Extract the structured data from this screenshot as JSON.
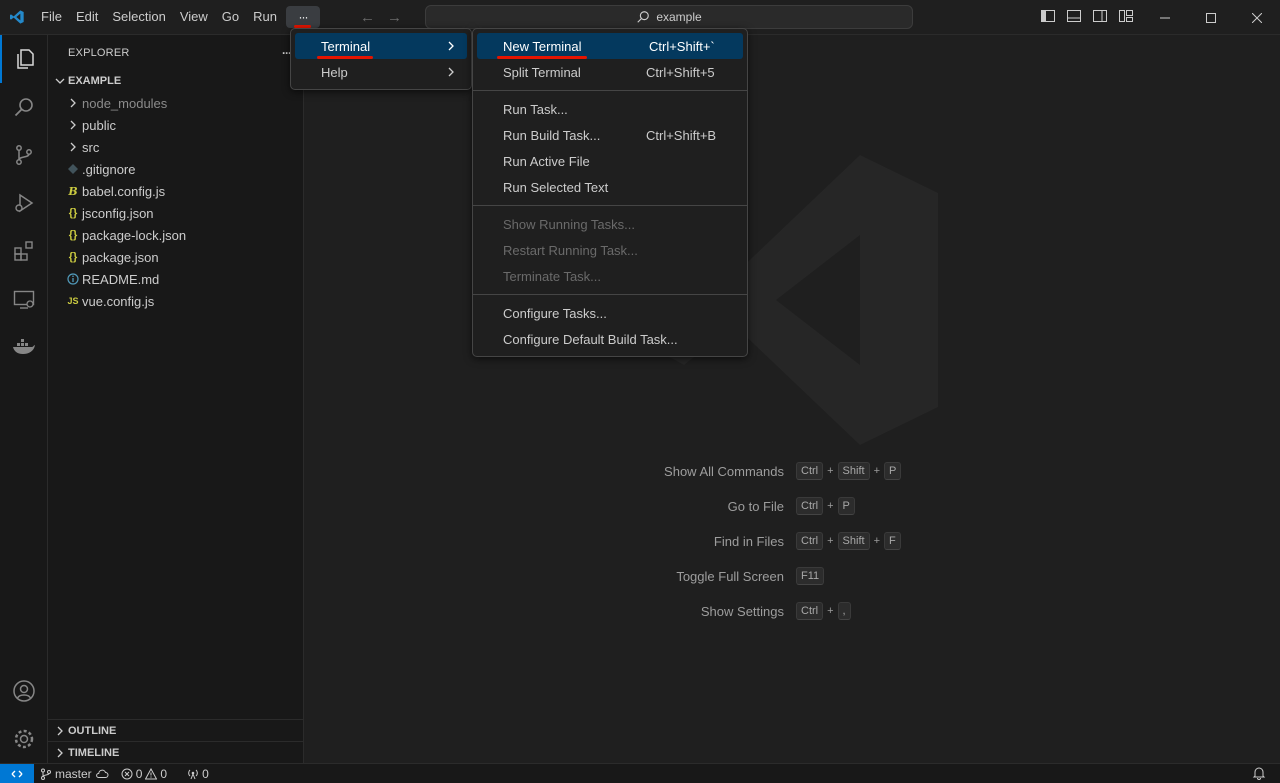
{
  "titlebar": {
    "menus": [
      "File",
      "Edit",
      "Selection",
      "View",
      "Go",
      "Run"
    ],
    "more_label": "···",
    "search_text": "example"
  },
  "sidebar": {
    "header": "EXPLORER",
    "header_more": "···",
    "folder": "EXAMPLE",
    "items": [
      {
        "label": "node_modules",
        "type": "folder"
      },
      {
        "label": "public",
        "type": "folder"
      },
      {
        "label": "src",
        "type": "folder"
      },
      {
        "label": ".gitignore",
        "type": "git"
      },
      {
        "label": "babel.config.js",
        "type": "babel"
      },
      {
        "label": "jsconfig.json",
        "type": "json"
      },
      {
        "label": "package-lock.json",
        "type": "json"
      },
      {
        "label": "package.json",
        "type": "json"
      },
      {
        "label": "README.md",
        "type": "info"
      },
      {
        "label": "vue.config.js",
        "type": "js"
      }
    ],
    "outline": "OUTLINE",
    "timeline": "TIMELINE"
  },
  "menu_main": {
    "items": [
      {
        "label": "Terminal",
        "selected": true
      },
      {
        "label": "Help",
        "selected": false
      }
    ]
  },
  "menu_terminal": {
    "group1": [
      {
        "label": "New Terminal",
        "shortcut": "Ctrl+Shift+`"
      },
      {
        "label": "Split Terminal",
        "shortcut": "Ctrl+Shift+5"
      }
    ],
    "group2": [
      {
        "label": "Run Task...",
        "shortcut": ""
      },
      {
        "label": "Run Build Task...",
        "shortcut": "Ctrl+Shift+B"
      },
      {
        "label": "Run Active File",
        "shortcut": ""
      },
      {
        "label": "Run Selected Text",
        "shortcut": ""
      }
    ],
    "group3": [
      {
        "label": "Show Running Tasks..."
      },
      {
        "label": "Restart Running Task..."
      },
      {
        "label": "Terminate Task..."
      }
    ],
    "group4": [
      {
        "label": "Configure Tasks..."
      },
      {
        "label": "Configure Default Build Task..."
      }
    ]
  },
  "shortcuts": [
    {
      "label": "Show All Commands",
      "keys": [
        "Ctrl",
        "Shift",
        "P"
      ]
    },
    {
      "label": "Go to File",
      "keys": [
        "Ctrl",
        "P"
      ]
    },
    {
      "label": "Find in Files",
      "keys": [
        "Ctrl",
        "Shift",
        "F"
      ]
    },
    {
      "label": "Toggle Full Screen",
      "keys": [
        "F11"
      ]
    },
    {
      "label": "Show Settings",
      "keys": [
        "Ctrl",
        ","
      ]
    }
  ],
  "statusbar": {
    "branch": "master",
    "errors": "0",
    "warnings": "0",
    "ports": "0"
  },
  "colors": {
    "accent": "#0078d4",
    "menu_selected": "#04395e",
    "annotation_red": "#e51400"
  }
}
